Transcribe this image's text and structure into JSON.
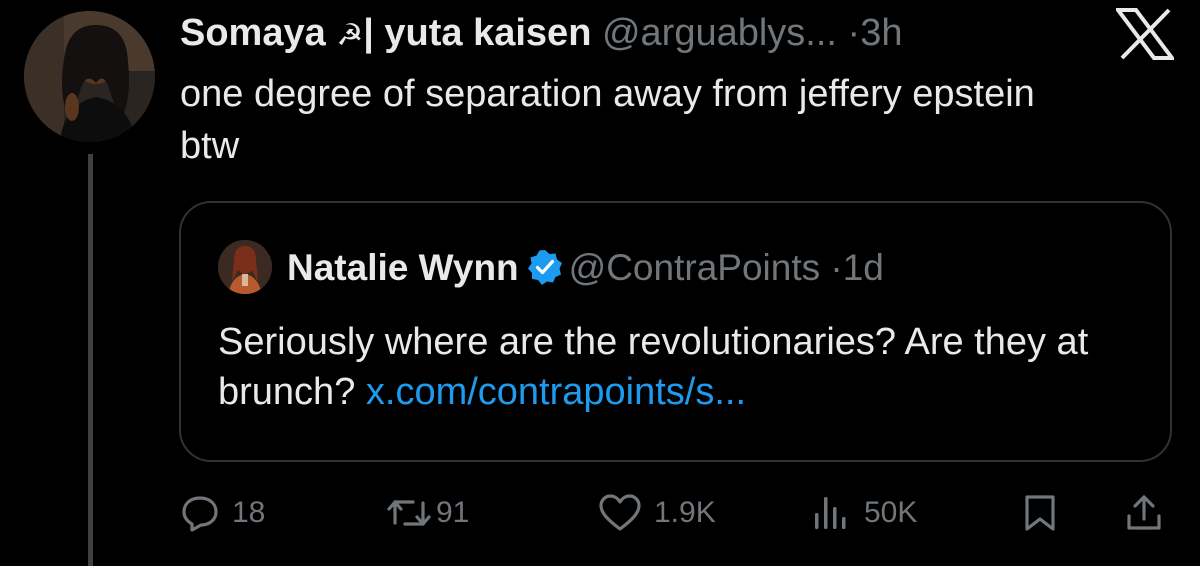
{
  "tweet": {
    "author_name": "Somaya",
    "author_emoji": "☭",
    "name_suffix": "| yuta kaisen",
    "handle": "@arguablys...",
    "dot": "·",
    "time": "3h",
    "text": "one degree of separation away from jeffery epstein btw"
  },
  "quote": {
    "author_name": "Natalie Wynn",
    "handle": "@ContraPoints",
    "dot": "·",
    "time": "1d",
    "text": "Seriously where are the revolutionaries? Are they at brunch?",
    "link": "x.com/contrapoints/s..."
  },
  "actions": {
    "replies": "18",
    "reposts": "91",
    "likes": "1.9K",
    "views": "50K"
  },
  "icons": {
    "logo": "x-logo-icon",
    "verified": "verified-badge-icon",
    "reply": "reply-icon",
    "repost": "repost-icon",
    "like": "heart-icon",
    "views": "views-icon",
    "bookmark": "bookmark-icon",
    "share": "share-icon"
  },
  "colors": {
    "background": "#000000",
    "text": "#e7e9ea",
    "muted": "#71767b",
    "link": "#1d9bf0",
    "border": "#2f3336"
  }
}
